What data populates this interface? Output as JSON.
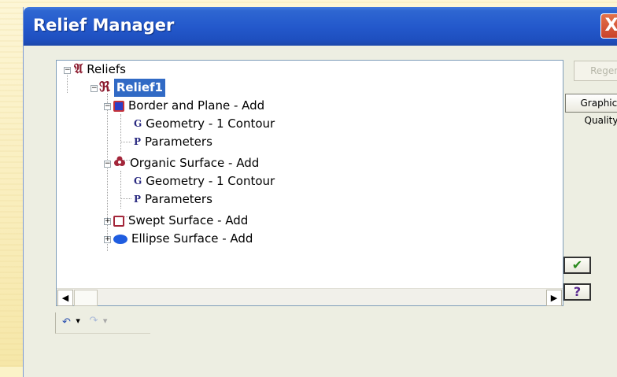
{
  "window": {
    "title": "Relief Manager",
    "close_glyph": "X"
  },
  "tree": {
    "nodes": [
      {
        "label": "Reliefs",
        "icon": "reliefs-gothic-a-icon",
        "glyph": "𝔄"
      },
      {
        "label": "Relief1",
        "icon": "relief-gothic-r-icon",
        "glyph": "ℜ",
        "selected": true
      },
      {
        "label": "Border and Plane - Add",
        "icon": "border-plane-square-icon"
      },
      {
        "label": "Geometry - 1 Contour",
        "icon": "geometry-g-icon",
        "glyph": "G"
      },
      {
        "label": "Parameters",
        "icon": "parameters-p-icon",
        "glyph": "P"
      },
      {
        "label": "Organic Surface - Add",
        "icon": "organic-surface-icon"
      },
      {
        "label": "Geometry - 1 Contour",
        "icon": "geometry-g-icon",
        "glyph": "G"
      },
      {
        "label": "Parameters",
        "icon": "parameters-p-icon",
        "glyph": "P"
      },
      {
        "label": "Swept Surface - Add",
        "icon": "swept-surface-square-icon"
      },
      {
        "label": "Ellipse Surface - Add",
        "icon": "ellipse-surface-icon"
      }
    ]
  },
  "buttons": {
    "regen": "Regen",
    "graphics_quality": "Graphics Quality",
    "ok_glyph": "✔",
    "help_glyph": "?"
  },
  "undo": {
    "undo_glyph": "↶",
    "redo_glyph": "↷",
    "dropdown_glyph": "▾"
  },
  "scroll": {
    "left_glyph": "◀",
    "right_glyph": "▶"
  },
  "colors": {
    "titlebar": "#2459cc",
    "selection": "#316ac5",
    "close": "#d0502f"
  }
}
